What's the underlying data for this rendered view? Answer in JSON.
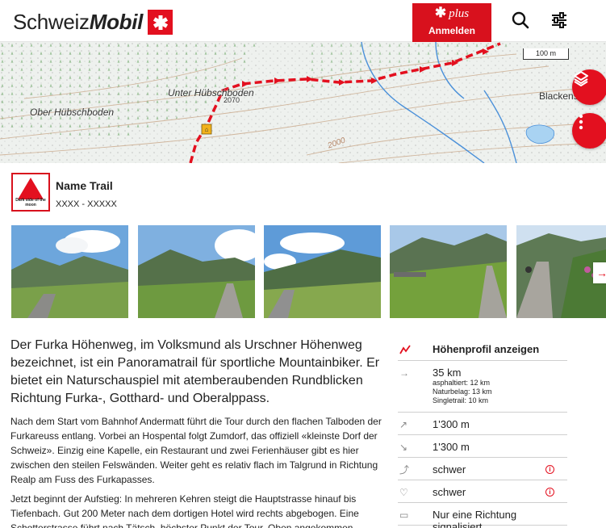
{
  "header": {
    "logo_word1": "Schweiz",
    "logo_word2": "Mobil",
    "plus_label": "plus",
    "login_label": "Anmelden"
  },
  "map": {
    "labels": [
      "Unter Hübschboden",
      "Ober Hübschboden",
      "Blackens",
      "2070",
      "2000"
    ],
    "scale_label": "100 m"
  },
  "trail": {
    "logo_caption": "Dark side of the moon",
    "name": "Name Trail",
    "subtitle": "XXXX  - XXXXX"
  },
  "lead": "Der Furka Höhenweg, im Volksmund als Urschner Höhenweg bezeichnet, ist ein Panoramatrail für sportliche Mountainbiker. Er bietet ein Naturschauspiel mit atemberaubenden Rundblicken Richtung Furka-, Gotthard- und Oberalppass.",
  "paragraphs": [
    "Nach dem Start vom Bahnhof Andermatt führt die Tour durch den flachen Talboden der Furkareuss entlang. Vorbei an Hospental folgt Zumdorf, das offiziell «kleinste Dorf der Schweiz». Einzig eine Kapelle, ein Restaurant und zwei Ferienhäuser gibt es hier zwischen den steilen Felswänden. Weiter geht es relativ flach im Talgrund in Richtung Realp am Fuss des Furkapasses.",
    "Jetzt beginnt der Aufstieg: In mehreren Kehren steigt die Hauptstrasse hinauf bis Tiefenbach. Gut 200 Meter nach dem dortigen Hotel wird rechts abgebogen. Eine Schotterstrasse führt nach Tätsch, höchster Punkt der Tour. Oben angekommen"
  ],
  "stats": {
    "profile_label": "Höhenprofil anzeigen",
    "distance": "35 km",
    "distance_details": [
      "asphaltiert: 12 km",
      "Naturbelag: 13 km",
      "Singletrail: 10 km"
    ],
    "ascent": "1'300 m",
    "descent": "1'300 m",
    "technique": "schwer",
    "fitness": "schwer",
    "signage": "Nur eine Richtung signalisiert"
  },
  "colors": {
    "brand_red": "#e3101f",
    "route_red": "#e3101f"
  }
}
